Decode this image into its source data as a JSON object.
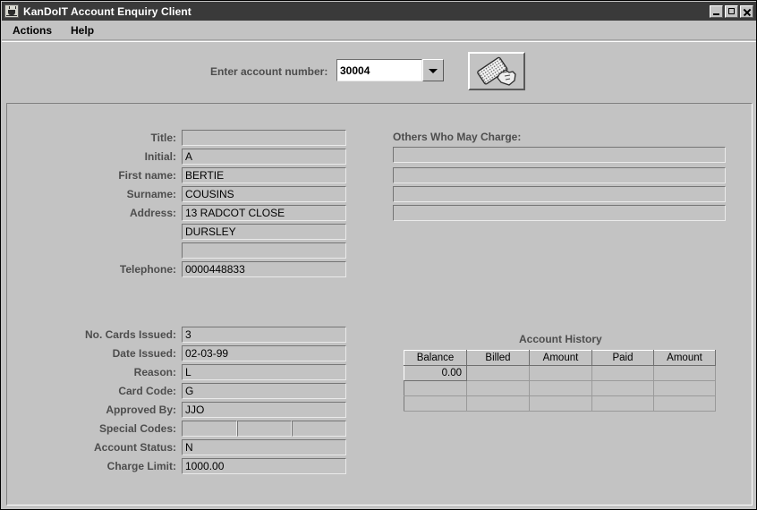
{
  "window": {
    "title": "KanDoIT Account Enquiry Client",
    "icon": "java-coffee-cup-icon",
    "minimize_label": "",
    "maximize_label": "",
    "close_label": ""
  },
  "menubar": {
    "items": [
      {
        "label": "Actions"
      },
      {
        "label": "Help"
      }
    ]
  },
  "toolbar": {
    "account_label": "Enter account number:",
    "account_value": "30004",
    "account_placeholder": "",
    "swipe_button_icon": "card-swipe-hand-icon"
  },
  "form": {
    "personal": [
      {
        "label": "Title:",
        "value": ""
      },
      {
        "label": "Initial:",
        "value": "A"
      },
      {
        "label": "First name:",
        "value": "BERTIE"
      },
      {
        "label": "Surname:",
        "value": "COUSINS"
      },
      {
        "label": "Address:",
        "value": "13 RADCOT CLOSE"
      },
      {
        "label": "",
        "value": "DURSLEY"
      },
      {
        "label": "",
        "value": ""
      },
      {
        "label": "Telephone:",
        "value": "0000448833"
      }
    ],
    "account": [
      {
        "label": "No. Cards Issued:",
        "value": "3"
      },
      {
        "label": "Date Issued:",
        "value": "02-03-99"
      },
      {
        "label": "Reason:",
        "value": "L"
      },
      {
        "label": "Card Code:",
        "value": "G"
      },
      {
        "label": "Approved By:",
        "value": "JJO"
      }
    ],
    "special_codes_label": "Special Codes:",
    "special_codes": [
      "",
      "",
      ""
    ],
    "account_status": {
      "label": "Account Status:",
      "value": "N"
    },
    "charge_limit": {
      "label": "Charge Limit:",
      "value": "1000.00"
    }
  },
  "others": {
    "label": "Others Who May Charge:",
    "rows": [
      "",
      "",
      "",
      ""
    ]
  },
  "history": {
    "title": "Account History",
    "columns": [
      "Balance",
      "Billed",
      "Amount",
      "Paid",
      "Amount"
    ],
    "rows": [
      [
        "0.00",
        "",
        "",
        "",
        ""
      ],
      [
        "",
        "",
        "",
        "",
        ""
      ],
      [
        "",
        "",
        "",
        "",
        ""
      ]
    ]
  },
  "colors": {
    "window_bg": "#c3c3c3",
    "titlebar_bg": "#3a3a3a",
    "titlebar_text": "#ffffff",
    "label_text": "#4d4d4d",
    "field_text": "#000000",
    "combo_bg": "#ffffff"
  }
}
